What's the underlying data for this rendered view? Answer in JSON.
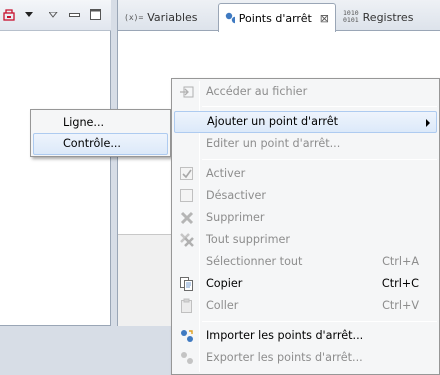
{
  "tabs": [
    {
      "icon_text": "(x)=",
      "label": "Variables",
      "icon": "variables-icon"
    },
    {
      "label": "Points d'arrêt",
      "icon": "breakpoints-icon",
      "close": "⊠"
    },
    {
      "icon_text": "1010\n0101",
      "label": "Registres",
      "icon": "registers-icon"
    }
  ],
  "context_menu": {
    "items": [
      {
        "label": "Accéder au fichier",
        "icon": "go-to-file-icon",
        "disabled": true
      },
      {
        "label": "Ajouter un point d'arrêt",
        "submenu": true,
        "highlighted": true
      },
      {
        "label": "Editer un point d'arrêt...",
        "disabled": true
      },
      {
        "label": "Activer",
        "icon": "checkmark-icon",
        "disabled": true
      },
      {
        "label": "Désactiver",
        "icon": "unchecked-icon",
        "disabled": true
      },
      {
        "label": "Supprimer",
        "icon": "remove-icon",
        "disabled": true
      },
      {
        "label": "Tout supprimer",
        "icon": "remove-all-icon",
        "disabled": true
      },
      {
        "label": "Sélectionner tout",
        "shortcut": "Ctrl+A",
        "disabled": true
      },
      {
        "label": "Copier",
        "shortcut": "Ctrl+C",
        "icon": "copy-icon",
        "disabled": false
      },
      {
        "label": "Coller",
        "shortcut": "Ctrl+V",
        "icon": "paste-icon",
        "disabled": true
      },
      {
        "label": "Importer les points d'arrêt...",
        "icon": "import-icon",
        "disabled": false
      },
      {
        "label": "Exporter les points d'arrêt...",
        "icon": "export-icon",
        "disabled": true
      }
    ]
  },
  "submenu": {
    "items": [
      {
        "label": "Ligne..."
      },
      {
        "label": "Contrôle...",
        "highlighted": true
      }
    ]
  },
  "colors": {
    "highlight_border": "#aecbf0",
    "disabled_text": "#8d8d8d",
    "accent_red": "#c8102e"
  }
}
